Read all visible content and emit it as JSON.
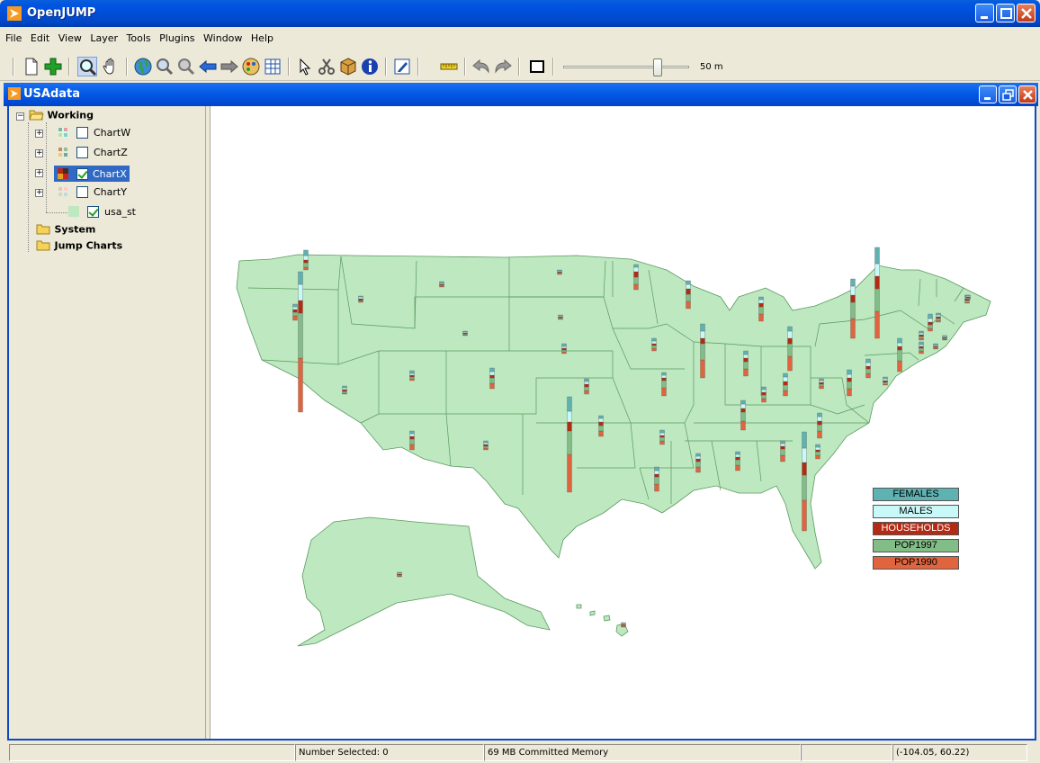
{
  "app": {
    "title": "OpenJUMP"
  },
  "menu": [
    "File",
    "Edit",
    "View",
    "Layer",
    "Tools",
    "Plugins",
    "Window",
    "Help"
  ],
  "toolbar": {
    "scale_label": "50 m",
    "zoom_slider_position": 0.73
  },
  "frame": {
    "title": "USAdata"
  },
  "layers": {
    "categories": [
      {
        "name": "Working",
        "expanded": true
      },
      {
        "name": "System",
        "expanded": false
      },
      {
        "name": "Jump Charts",
        "expanded": false
      }
    ],
    "items": [
      {
        "name": "ChartW",
        "visible": false,
        "selected": false
      },
      {
        "name": "ChartZ",
        "visible": false,
        "selected": false
      },
      {
        "name": "ChartX",
        "visible": true,
        "selected": true
      },
      {
        "name": "ChartY",
        "visible": false,
        "selected": false
      },
      {
        "name": "usa_st",
        "visible": true,
        "selected": false
      }
    ]
  },
  "legend": [
    {
      "label": "FEMALES",
      "color": "#5fb2b2"
    },
    {
      "label": "MALES",
      "color": "#c8f8f8"
    },
    {
      "label": "HOUSEHOLDS",
      "color": "#b52a12"
    },
    {
      "label": "POP1997",
      "color": "#82bc86"
    },
    {
      "label": "POP1990",
      "color": "#e0643e"
    }
  ],
  "status": {
    "message": "",
    "selected": "Number Selected: 0",
    "memory": "69 MB Committed Memory",
    "extra": "",
    "coords": "(-104.05, 60.22)"
  },
  "colors": {
    "land": "#bde8c0",
    "border": "#5a9a5e"
  }
}
